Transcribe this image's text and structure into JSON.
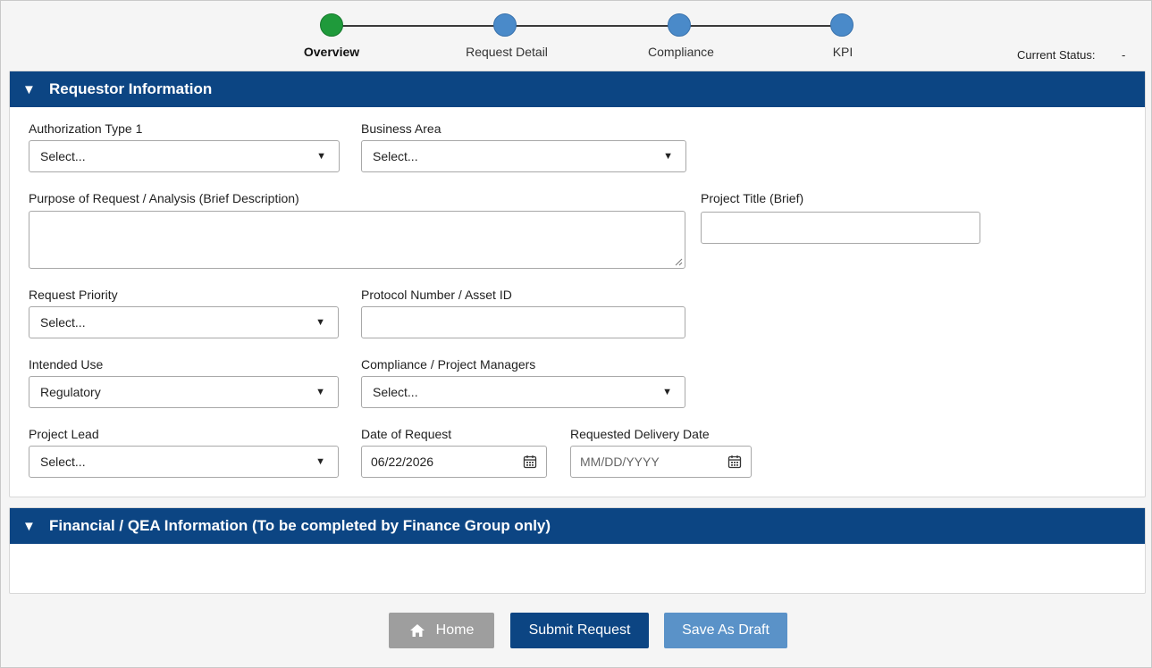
{
  "stepper": {
    "steps": [
      {
        "label": "Overview",
        "state": "complete",
        "color": "#1f9a3b"
      },
      {
        "label": "Request Detail",
        "state": "pending",
        "color": "#4a8ac9"
      },
      {
        "label": "Compliance",
        "state": "pending",
        "color": "#4a8ac9"
      },
      {
        "label": "KPI",
        "state": "pending",
        "color": "#4a8ac9"
      }
    ],
    "current_status_label": "Current Status:",
    "current_status_value": "-"
  },
  "requestor_section": {
    "title": "Requestor Information",
    "fields": {
      "authorization_type": {
        "label": "Authorization Type 1",
        "value": "Select..."
      },
      "business_area": {
        "label": "Business Area",
        "value": "Select..."
      },
      "purpose": {
        "label": "Purpose of Request / Analysis (Brief Description)",
        "value": ""
      },
      "project_title": {
        "label": "Project Title (Brief)",
        "value": ""
      },
      "request_priority": {
        "label": "Request Priority",
        "value": "Select..."
      },
      "protocol_number": {
        "label": "Protocol Number / Asset ID",
        "value": ""
      },
      "intended_use": {
        "label": "Intended Use",
        "value": "Regulatory"
      },
      "compliance_managers": {
        "label": "Compliance / Project Managers",
        "value": "Select..."
      },
      "project_lead": {
        "label": "Project Lead",
        "value": "Select..."
      },
      "date_of_request": {
        "label": "Date of Request",
        "value": "06/22/2026"
      },
      "requested_delivery_date": {
        "label": "Requested Delivery Date",
        "placeholder": "MM/DD/YYYY"
      }
    }
  },
  "financial_section": {
    "title": "Financial / QEA Information (To be completed by Finance Group only)"
  },
  "actions": {
    "home_label": "Home",
    "submit_label": "Submit Request",
    "draft_label": "Save As Draft"
  },
  "colors": {
    "header_blue": "#0c4583",
    "accent_blue": "#4a8ac9",
    "complete_green": "#1f9a3b",
    "disabled_gray": "#9e9e9e"
  }
}
